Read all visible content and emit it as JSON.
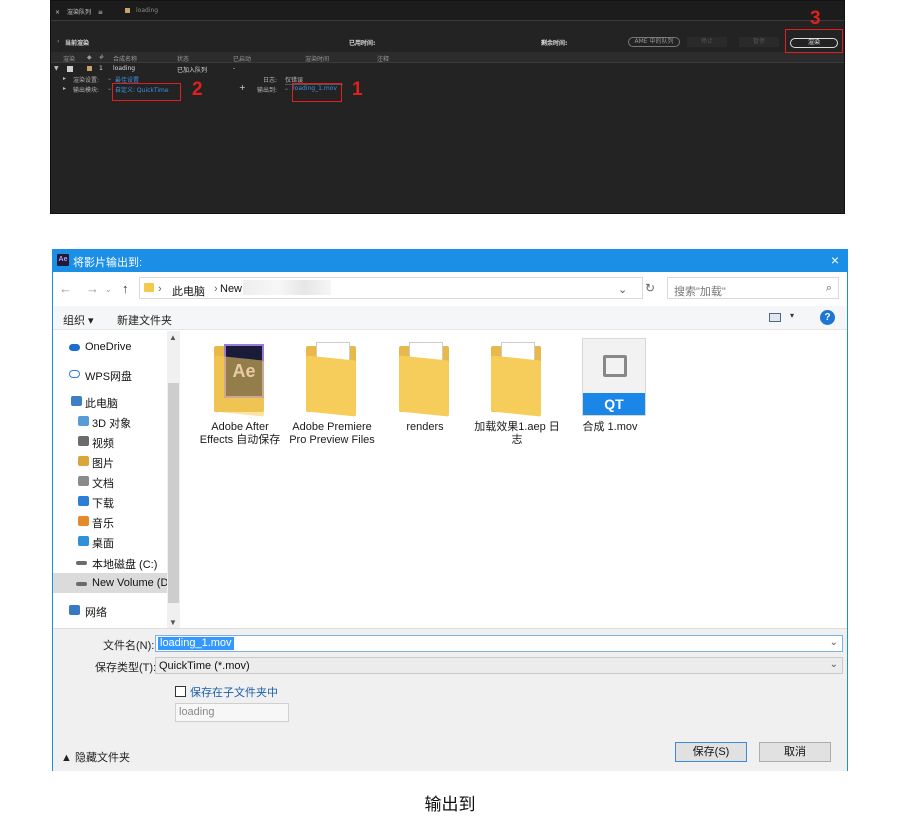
{
  "render_queue": {
    "tabs": [
      {
        "close": "×",
        "label": "渲染队列",
        "menu": "≡"
      },
      {
        "label": "loading"
      }
    ],
    "current_render_label": "当前渲染",
    "elapsed_label": "已用时间:",
    "remaining_label": "剩余时间:",
    "ame_queue_button": "AME 中的队列",
    "stop_button": "停止",
    "pause_button": "暂停",
    "render_button": "渲染",
    "columns": [
      "渲染",
      "#",
      "合成名称",
      "状态",
      "已启动",
      "渲染时间",
      "注释"
    ],
    "item": {
      "index": "1",
      "comp_name": "loading",
      "status": "已加入队列",
      "started": "-"
    },
    "render_settings_label": "渲染设置:",
    "render_settings_value": "最佳设置",
    "log_label": "日志:",
    "log_value": "仅错误",
    "output_module_label": "输出模块:",
    "output_module_value": "自定义: QuickTime",
    "output_to_label": "输出到:",
    "output_to_value": "loading_1.mov",
    "add_symbol": "+",
    "callouts": [
      "1",
      "2",
      "3"
    ],
    "callout_color": "#e0201c"
  },
  "dialog": {
    "title": "将影片输出到:",
    "app_icon_text": "Ae",
    "close_glyph": "×",
    "address": {
      "back": "←",
      "forward": "→",
      "up": "↑",
      "separator": "›",
      "crumbs": [
        "此电脑",
        "New Volume (D:)"
      ],
      "dropdown": "⌄",
      "refresh": "↻"
    },
    "search_placeholder": "搜索\"加载\"",
    "search_glyph": "⌕",
    "toolbar": {
      "organize": "组织 ▾",
      "new_folder": "新建文件夹",
      "view_dropdown": "▾",
      "help": "?"
    },
    "nav_items": [
      {
        "label": "OneDrive",
        "color": "#1b6fc9"
      },
      {
        "label": "WPS网盘",
        "color": "#2c7be5"
      },
      {
        "label": "此电脑",
        "color": "#3d7fc4"
      },
      {
        "label": "3D 对象",
        "color": "#5b9bd5"
      },
      {
        "label": "视频",
        "color": "#6b6b6b"
      },
      {
        "label": "图片",
        "color": "#d9a63a"
      },
      {
        "label": "文档",
        "color": "#8a8a8a"
      },
      {
        "label": "下载",
        "color": "#2a7fd4"
      },
      {
        "label": "音乐",
        "color": "#e48a2b"
      },
      {
        "label": "桌面",
        "color": "#2f8fd8"
      },
      {
        "label": "本地磁盘 (C:)",
        "color": "#6b6b6b"
      },
      {
        "label": "New Volume (D",
        "color": "#6b6b6b"
      },
      {
        "label": "网络",
        "color": "#3a78c4"
      }
    ],
    "files": [
      {
        "name": "Adobe After Effects 自动保存",
        "icon": "ae-folder-icon"
      },
      {
        "name": "Adobe Premiere Pro Preview Files",
        "icon": "folder-icon"
      },
      {
        "name": "renders",
        "icon": "folder-icon"
      },
      {
        "name": "加载效果1.aep 日志",
        "icon": "folder-icon"
      },
      {
        "name": "合成 1.mov",
        "icon": "quicktime-file-icon",
        "badge": "QT"
      }
    ],
    "filename_label": "文件名(N):",
    "filename_value": "loading_1.mov",
    "filetype_label": "保存类型(T):",
    "filetype_value": "QuickTime (*.mov)",
    "subfolder_checkbox_label": "保存在子文件夹中",
    "subfolder_checked": false,
    "subfolder_value": "loading",
    "hide_folders": "▲ 隐藏文件夹",
    "save_button": "保存(S)",
    "cancel_button": "取消",
    "accent_color": "#1b8fe6"
  },
  "caption": "输出到"
}
